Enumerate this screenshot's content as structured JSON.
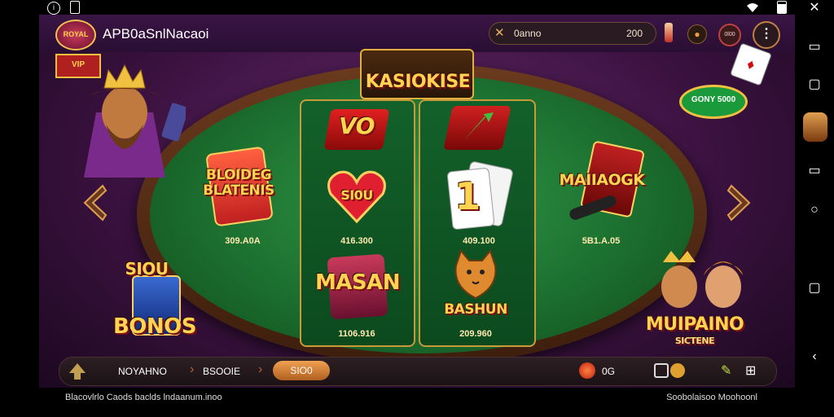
{
  "app": {
    "logo_text": "ROYAL",
    "title": "APB0aSnlNacaoi"
  },
  "status": {
    "left_icons": [
      "info-icon",
      "phone-icon"
    ],
    "right_icons": [
      "wifi-icon",
      "battery-icon"
    ]
  },
  "header": {
    "balance_label": "0anno",
    "balance_value": "200",
    "badge_text": "0l00"
  },
  "table": {
    "title": "KASIOKISE"
  },
  "games": [
    {
      "name": "BLOIDEG BLATENIS",
      "score": "309.A0A",
      "side": "left"
    },
    {
      "name": "VO",
      "score": "",
      "side": "center-top-1"
    },
    {
      "name": "SI0U",
      "score": "416.300",
      "side": "center-mid-1"
    },
    {
      "name": "1",
      "score": "409.100",
      "side": "center-mid-2"
    },
    {
      "name": "MAIIAOGK",
      "score": "5B1.A.05",
      "side": "right"
    },
    {
      "name": "MASAN",
      "score": "1106.916",
      "side": "center-low-1"
    },
    {
      "name": "BASHUN",
      "score": "209.960",
      "side": "center-low-2"
    }
  ],
  "corners": {
    "bottom_left_top": "SIOU",
    "bottom_left_bottom": "BONOS",
    "bottom_right_top": "MUIPAINO",
    "bottom_right_bottom": "SICTENE",
    "top_right_chip": "GONY 5000"
  },
  "bottom_nav": {
    "items": [
      "NOYAHNO",
      "BSOOIE",
      "SIO0"
    ],
    "counter": "0G"
  },
  "footer": {
    "left": "Blacovlrlo Caods baclds lndaanum.inoo",
    "right": "Soobolaisoo Moohoonl"
  },
  "colors": {
    "felt": "#1c6f2f",
    "gold": "#ffd451",
    "accent": "#e8a040"
  }
}
